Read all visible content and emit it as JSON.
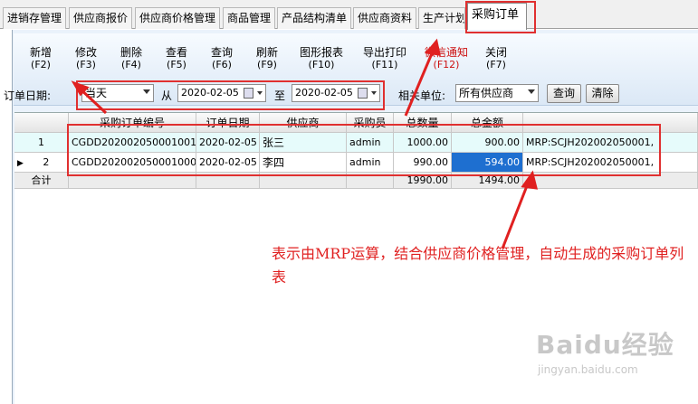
{
  "tabs": [
    {
      "label": "进销存管理"
    },
    {
      "label": "供应商报价"
    },
    {
      "label": "供应商价格管理"
    },
    {
      "label": "商品管理"
    },
    {
      "label": "产品结构清单"
    },
    {
      "label": "供应商资料"
    },
    {
      "label": "生产计划"
    },
    {
      "label": "采购订单",
      "active": true
    }
  ],
  "toolbar": [
    {
      "label": "新增",
      "key": "(F2)"
    },
    {
      "label": "修改",
      "key": "(F3)"
    },
    {
      "label": "删除",
      "key": "(F4)"
    },
    {
      "label": "查看",
      "key": "(F5)"
    },
    {
      "label": "查询",
      "key": "(F6)"
    },
    {
      "label": "刷新",
      "key": "(F9)"
    },
    {
      "label": "图形报表",
      "key": "(F10)"
    },
    {
      "label": "导出打印",
      "key": "(F11)"
    },
    {
      "label": "微信通知",
      "key": "(F12)"
    },
    {
      "label": "关闭",
      "key": "(F7)"
    }
  ],
  "filter": {
    "order_date_label": "订单日期:",
    "period_value": "当天",
    "from_label": "从",
    "date_from": "2020-02-05",
    "to_label": "至",
    "date_to": "2020-02-05",
    "unit_label": "相关单位:",
    "unit_value": "所有供应商",
    "query_button": "查询",
    "clear_button": "清除"
  },
  "grid": {
    "columns": [
      "采购订单编号",
      "订单日期",
      "供应商",
      "采购员",
      "总数量",
      "总金额",
      ""
    ],
    "rows": [
      {
        "index": "1",
        "pointer": "",
        "order_no": "CGDD202002050001001",
        "date": "2020-02-05",
        "supplier": "张三",
        "buyer": "admin",
        "qty": "1000.00",
        "amount": "900.00",
        "note": "MRP:SCJH202002050001,"
      },
      {
        "index": "2",
        "pointer": "▶",
        "order_no": "CGDD202002050001000",
        "date": "2020-02-05",
        "supplier": "李四",
        "buyer": "admin",
        "qty": "990.00",
        "amount": "594.00",
        "note": "MRP:SCJH202002050001,"
      }
    ],
    "summary": {
      "label": "合计",
      "qty": "1990.00",
      "amount": "1494.00"
    }
  },
  "annotation": {
    "text": "表示由MRP运算，结合供应商价格管理，自动生成的采购订单列表"
  },
  "watermark": {
    "brand": "Baidu经验",
    "url": "jingyan.baidu.com"
  },
  "colors": {
    "annotation": "#e02020",
    "selected_cell": "#1e6fd0",
    "row_highlight": "#e6fbfb",
    "wechat_button": "#cc1010"
  }
}
